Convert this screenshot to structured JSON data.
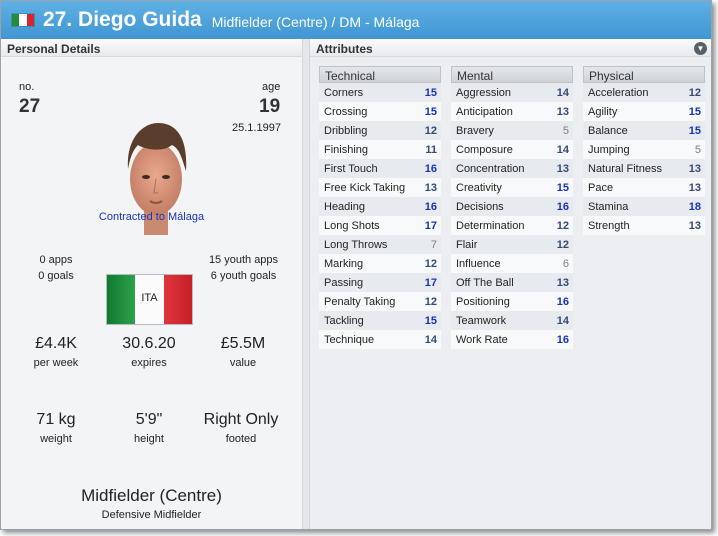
{
  "header": {
    "title": "27. Diego Guida",
    "subtitle": "Midfielder (Centre) / DM - Málaga",
    "flag_colors": [
      "#1f8f3a",
      "#ffffff",
      "#d3262e"
    ]
  },
  "personal": {
    "section_title": "Personal Details",
    "no_label": "no.",
    "no_value": "27",
    "age_label": "age",
    "age_value": "19",
    "dob": "25.1.1997",
    "contract_status": "Contracted to Málaga",
    "apps": "0 apps",
    "goals": "0 goals",
    "youth_apps": "15 youth apps",
    "youth_goals": "6 youth goals",
    "nation": "ITA",
    "wage_value": "£4.4K",
    "wage_label": "per week",
    "expires_value": "30.6.20",
    "expires_label": "expires",
    "value_value": "£5.5M",
    "value_label": "value",
    "weight_value": "71 kg",
    "weight_label": "weight",
    "height_value": "5'9\"",
    "height_label": "height",
    "foot_value": "Right Only",
    "foot_label": "footed",
    "position": "Midfielder (Centre)",
    "role": "Defensive Midfielder"
  },
  "attributes": {
    "section_title": "Attributes",
    "technical": {
      "title": "Technical",
      "rows": [
        {
          "name": "Corners",
          "value": "15"
        },
        {
          "name": "Crossing",
          "value": "15"
        },
        {
          "name": "Dribbling",
          "value": "12"
        },
        {
          "name": "Finishing",
          "value": "11"
        },
        {
          "name": "First Touch",
          "value": "16"
        },
        {
          "name": "Free Kick Taking",
          "value": "13"
        },
        {
          "name": "Heading",
          "value": "16"
        },
        {
          "name": "Long Shots",
          "value": "17"
        },
        {
          "name": "Long Throws",
          "value": "7"
        },
        {
          "name": "Marking",
          "value": "12"
        },
        {
          "name": "Passing",
          "value": "17"
        },
        {
          "name": "Penalty Taking",
          "value": "12"
        },
        {
          "name": "Tackling",
          "value": "15"
        },
        {
          "name": "Technique",
          "value": "14"
        }
      ]
    },
    "mental": {
      "title": "Mental",
      "rows": [
        {
          "name": "Aggression",
          "value": "14"
        },
        {
          "name": "Anticipation",
          "value": "13"
        },
        {
          "name": "Bravery",
          "value": "5"
        },
        {
          "name": "Composure",
          "value": "14"
        },
        {
          "name": "Concentration",
          "value": "13"
        },
        {
          "name": "Creativity",
          "value": "15"
        },
        {
          "name": "Decisions",
          "value": "16"
        },
        {
          "name": "Determination",
          "value": "12"
        },
        {
          "name": "Flair",
          "value": "12"
        },
        {
          "name": "Influence",
          "value": "6"
        },
        {
          "name": "Off The Ball",
          "value": "13"
        },
        {
          "name": "Positioning",
          "value": "16"
        },
        {
          "name": "Teamwork",
          "value": "14"
        },
        {
          "name": "Work Rate",
          "value": "16"
        }
      ]
    },
    "physical": {
      "title": "Physical",
      "rows": [
        {
          "name": "Acceleration",
          "value": "12"
        },
        {
          "name": "Agility",
          "value": "15"
        },
        {
          "name": "Balance",
          "value": "15"
        },
        {
          "name": "Jumping",
          "value": "5"
        },
        {
          "name": "Natural Fitness",
          "value": "13"
        },
        {
          "name": "Pace",
          "value": "13"
        },
        {
          "name": "Stamina",
          "value": "18"
        },
        {
          "name": "Strength",
          "value": "13"
        }
      ]
    },
    "menu_icon": "chevron-down-icon"
  }
}
